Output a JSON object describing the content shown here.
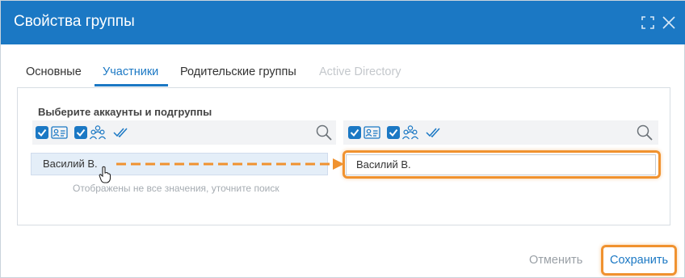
{
  "dialog": {
    "title": "Свойства группы"
  },
  "tabs": [
    {
      "label": "Основные",
      "active": false,
      "disabled": false
    },
    {
      "label": "Участники",
      "active": true,
      "disabled": false
    },
    {
      "label": "Родительские группы",
      "active": false,
      "disabled": false
    },
    {
      "label": "Active Directory",
      "active": false,
      "disabled": true
    }
  ],
  "members": {
    "section_label": "Выберите аккаунты и подгруппы",
    "left_list": {
      "items": [
        {
          "label": "Василий В."
        }
      ],
      "hint": "Отображены не все значения, уточните поиск"
    },
    "right_list": {
      "items": [
        {
          "label": "Василий В."
        }
      ]
    }
  },
  "footer": {
    "cancel_label": "Отменить",
    "save_label": "Сохранить"
  },
  "colors": {
    "accent": "#1b78c4",
    "highlight": "#f0922f",
    "selected_bg": "#e4eef8"
  }
}
